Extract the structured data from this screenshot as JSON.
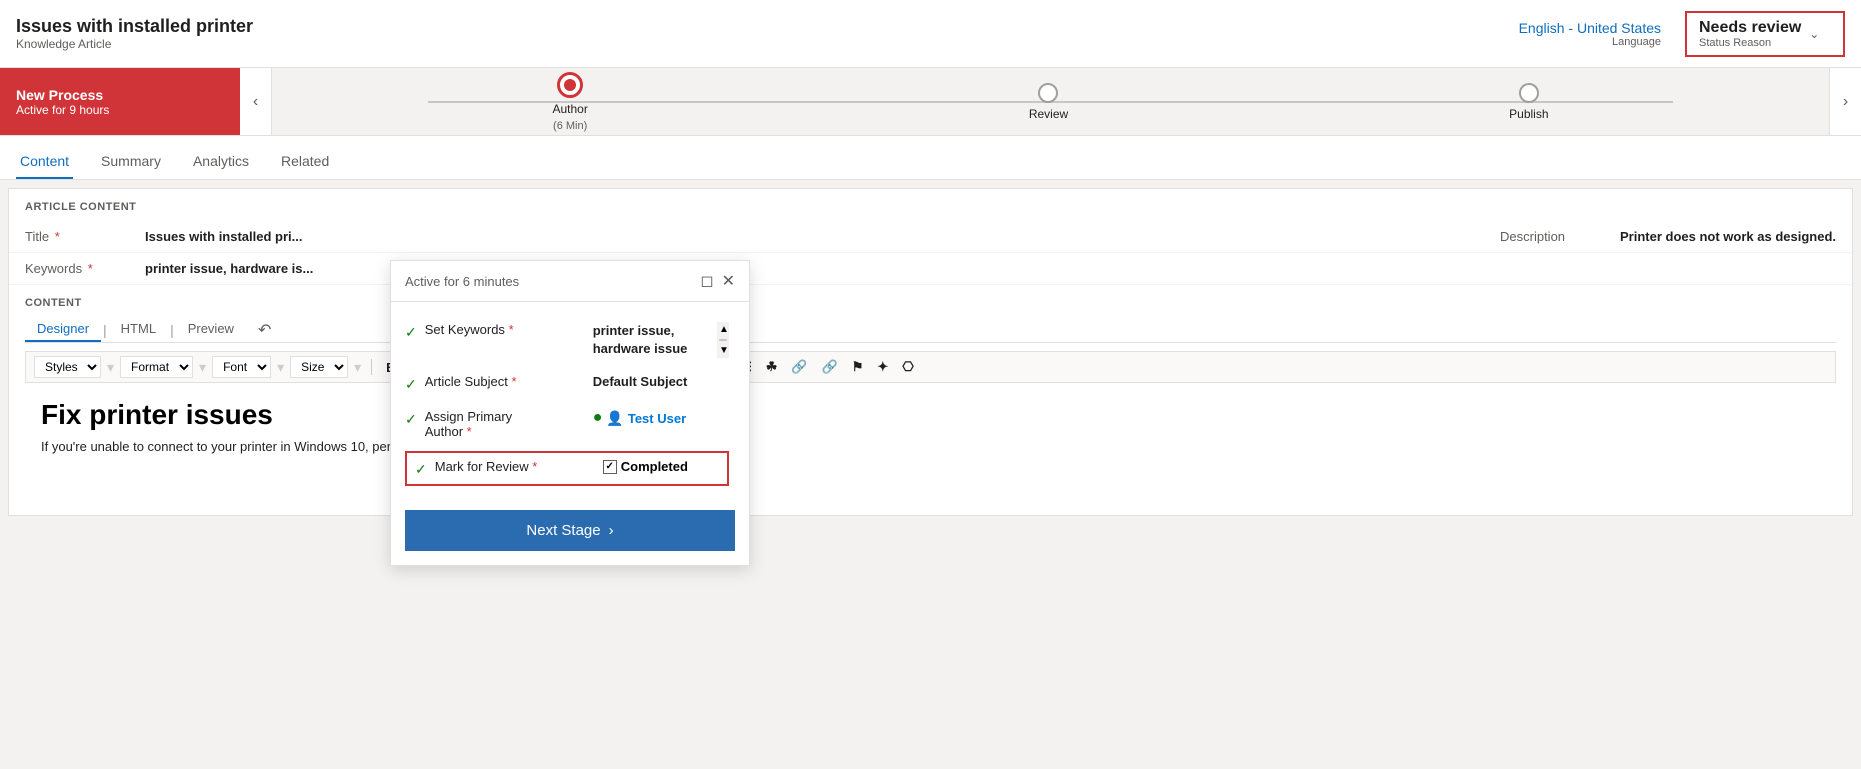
{
  "header": {
    "title": "Issues with installed printer",
    "subtitle": "Knowledge Article",
    "language_value": "English - United States",
    "language_label": "Language",
    "status_value": "Needs review",
    "status_label": "Status Reason"
  },
  "process_bar": {
    "new_process_title": "New Process",
    "new_process_sub": "Active for 9 hours",
    "stages": [
      {
        "label": "Author",
        "sublabel": "(6 Min)",
        "state": "active"
      },
      {
        "label": "Review",
        "sublabel": "",
        "state": "inactive"
      },
      {
        "label": "Publish",
        "sublabel": "",
        "state": "inactive"
      }
    ]
  },
  "tabs": [
    "Content",
    "Summary",
    "Analytics",
    "Related"
  ],
  "active_tab": "Content",
  "article_content": {
    "section_label": "ARTICLE CONTENT",
    "fields": [
      {
        "label": "Title",
        "required": true,
        "value": "Issues with installed pri..."
      },
      {
        "label": "Keywords",
        "required": true,
        "value": "printer issue, hardware is..."
      }
    ],
    "description_label": "Description",
    "description_value": "Printer does not work as designed."
  },
  "content_section": {
    "section_label": "CONTENT",
    "editor_tabs": [
      "Designer",
      "HTML",
      "Preview"
    ],
    "active_editor_tab": "Designer",
    "toolbar": {
      "styles_label": "Styles",
      "format_label": "Format",
      "font_label": "Font",
      "size_label": "Size"
    },
    "editor_heading": "Fix printer issues",
    "editor_body": "If you're unable to connect to your printer in Windows 10, perform one of the following steps to address the issue:"
  },
  "flyout": {
    "header_text": "Active for 6 minutes",
    "rows": [
      {
        "checked": true,
        "label": "Set Keywords",
        "required": true,
        "value": "printer issue, hardware issue",
        "is_keywords": true
      },
      {
        "checked": true,
        "label": "Article Subject",
        "required": true,
        "value": "Default Subject",
        "is_keywords": false
      },
      {
        "checked": true,
        "label": "Assign Primary Author",
        "required": true,
        "value": "Test User",
        "is_user": true
      },
      {
        "checked": true,
        "label": "Mark for Review",
        "required": true,
        "value": "Completed",
        "is_highlighted": true
      }
    ],
    "next_stage_label": "Next Stage"
  }
}
